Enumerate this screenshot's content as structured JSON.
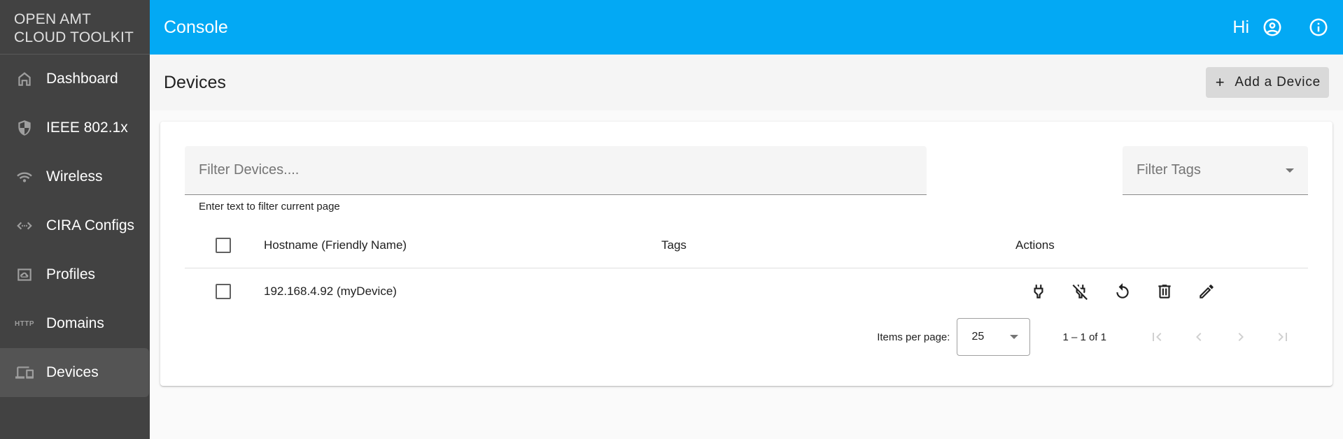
{
  "sidebar": {
    "brand_line1": "OPEN AMT",
    "brand_line2": "CLOUD TOOLKIT",
    "items": [
      {
        "label": "Dashboard",
        "icon": "home-icon",
        "active": false
      },
      {
        "label": "IEEE 802.1x",
        "icon": "shield-icon",
        "active": false
      },
      {
        "label": "Wireless",
        "icon": "wifi-icon",
        "active": false
      },
      {
        "label": "CIRA Configs",
        "icon": "code-arrows-icon",
        "active": false
      },
      {
        "label": "Profiles",
        "icon": "cloud-profile-icon",
        "active": false
      },
      {
        "label": "Domains",
        "icon": "http-icon",
        "icon_text": "HTTP",
        "active": false
      },
      {
        "label": "Devices",
        "icon": "devices-icon",
        "active": true
      }
    ]
  },
  "topbar": {
    "title": "Console",
    "greeting": "Hi",
    "account_icon": "account-circle-icon",
    "info_icon": "info-icon"
  },
  "page": {
    "title": "Devices",
    "add_button_label": "Add a Device",
    "add_button_icon": "plus-icon"
  },
  "filters": {
    "devices_placeholder": "Filter Devices....",
    "devices_value": "",
    "devices_hint": "Enter text to filter current page",
    "tags_placeholder": "Filter Tags"
  },
  "table": {
    "columns": [
      "Hostname (Friendly Name)",
      "Tags",
      "Actions"
    ],
    "rows": [
      {
        "hostname": "192.168.4.92 (myDevice)",
        "tags": "",
        "checked": false,
        "actions": [
          "power-plug-icon",
          "power-plug-off-icon",
          "restart-icon",
          "delete-icon",
          "edit-icon"
        ]
      }
    ]
  },
  "paginator": {
    "items_per_page_label": "Items per page:",
    "items_per_page": "25",
    "range_label": "1 – 1 of 1",
    "first_enabled": false,
    "prev_enabled": false,
    "next_enabled": false,
    "last_enabled": false
  }
}
